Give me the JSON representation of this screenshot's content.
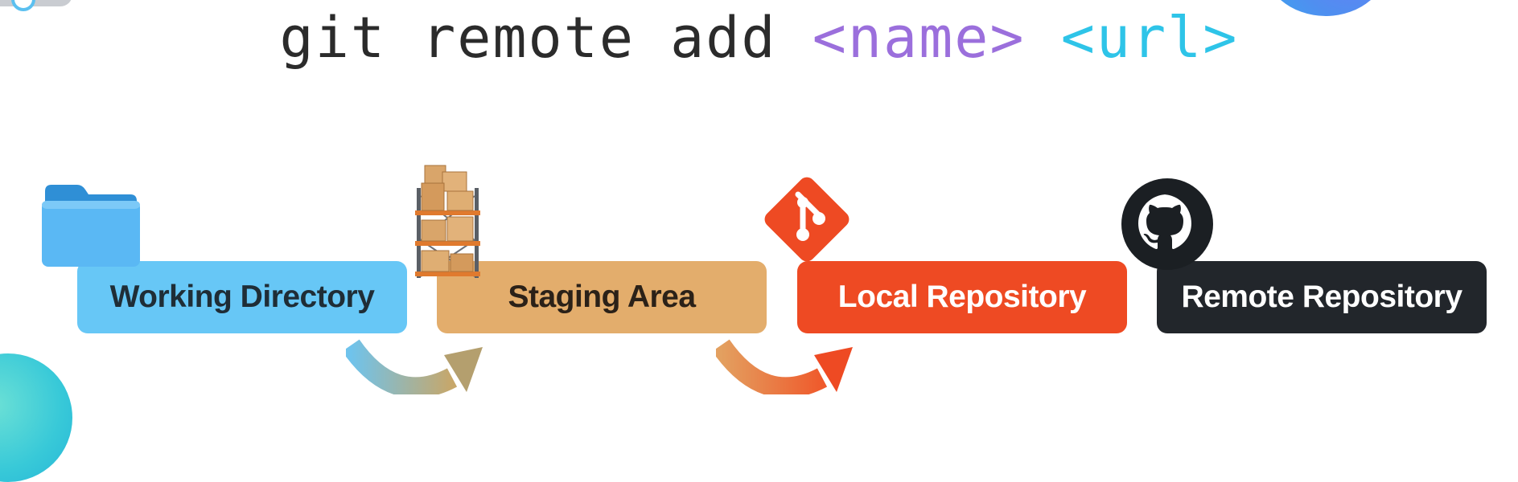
{
  "command": {
    "base": "git remote add ",
    "name_placeholder": "<name>",
    "separator": " ",
    "url_placeholder": "<url>"
  },
  "stages": [
    {
      "label": "Working Directory",
      "icon": "folder-icon",
      "color": "#67c7f6"
    },
    {
      "label": "Staging Area",
      "icon": "warehouse-shelf-icon",
      "color": "#e3ad6c"
    },
    {
      "label": "Local Repository",
      "icon": "git-logo-icon",
      "color": "#ee4a23"
    },
    {
      "label": "Remote Repository",
      "icon": "github-logo-icon",
      "color": "#22262b"
    }
  ],
  "colors": {
    "name_placeholder": "#9b6fdc",
    "url_placeholder": "#2ec4e8",
    "command_text": "#2b2b2b"
  }
}
